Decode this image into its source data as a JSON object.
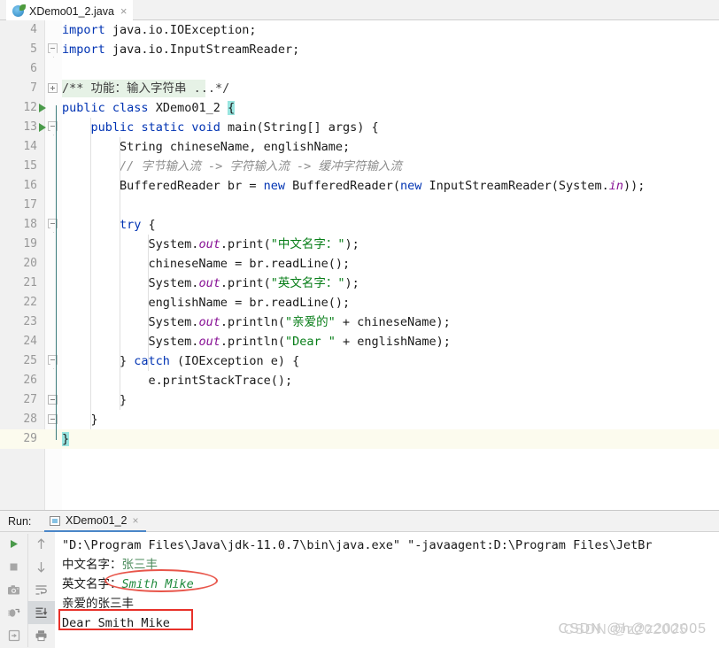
{
  "editor_tab": {
    "label": "XDemo01_2.java",
    "icon": "java-class-icon",
    "close": "×"
  },
  "code": {
    "lines": [
      {
        "num": "4",
        "indent": 0,
        "gutter": "none",
        "text": "import java.io.IOException;",
        "tokens": [
          {
            "t": "import",
            "c": "kw"
          },
          {
            "t": " java.io.IOException;",
            "c": ""
          }
        ]
      },
      {
        "num": "5",
        "indent": 0,
        "gutter": "fold-arrow",
        "text": "import java.io.InputStreamReader;",
        "tokens": [
          {
            "t": "import",
            "c": "kw"
          },
          {
            "t": " java.io.InputStreamReader;",
            "c": ""
          }
        ]
      },
      {
        "num": "6",
        "indent": 0,
        "gutter": "none",
        "text": "",
        "tokens": []
      },
      {
        "num": "7",
        "indent": 0,
        "gutter": "fold-plus",
        "folded_comment": true,
        "text": "/** 功能：输入字符串 ...*/",
        "tokens": [
          {
            "t": "/** 功能：输入字符串 ...*/",
            "c": "cmtdoc"
          }
        ]
      },
      {
        "num": "12",
        "indent": 0,
        "gutter": "run-arrow",
        "text": "public class XDemo01_2 {",
        "tokens": [
          {
            "t": "public",
            "c": "kw"
          },
          {
            "t": " ",
            "c": ""
          },
          {
            "t": "class",
            "c": "kw"
          },
          {
            "t": " XDemo01_2 ",
            "c": ""
          },
          {
            "t": "{",
            "c": "brace-hl"
          }
        ]
      },
      {
        "num": "13",
        "indent": 1,
        "gutter": "run-arrow-fold",
        "text": "    public static void main(String[] args) {",
        "tokens": [
          {
            "t": "    ",
            "c": ""
          },
          {
            "t": "public",
            "c": "kw"
          },
          {
            "t": " ",
            "c": ""
          },
          {
            "t": "static",
            "c": "kw"
          },
          {
            "t": " ",
            "c": ""
          },
          {
            "t": "void",
            "c": "kw"
          },
          {
            "t": " main(String[] args) {",
            "c": ""
          }
        ]
      },
      {
        "num": "14",
        "indent": 2,
        "gutter": "none",
        "text": "        String chineseName, englishName;",
        "tokens": [
          {
            "t": "        String chineseName, englishName;",
            "c": ""
          }
        ]
      },
      {
        "num": "15",
        "indent": 2,
        "gutter": "none",
        "text": "        // 字节输入流 -> 字符输入流 -> 缓冲字符输入流",
        "tokens": [
          {
            "t": "        ",
            "c": ""
          },
          {
            "t": "// 字节输入流 -> 字符输入流 -> 缓冲字符输入流",
            "c": "cmt"
          }
        ]
      },
      {
        "num": "16",
        "indent": 2,
        "gutter": "none",
        "text": "        BufferedReader br = new BufferedReader(new InputStreamReader(System.in));",
        "tokens": [
          {
            "t": "        BufferedReader br = ",
            "c": ""
          },
          {
            "t": "new",
            "c": "kw"
          },
          {
            "t": " BufferedReader(",
            "c": ""
          },
          {
            "t": "new",
            "c": "kw"
          },
          {
            "t": " InputStreamReader(System.",
            "c": ""
          },
          {
            "t": "in",
            "c": "fld"
          },
          {
            "t": "));",
            "c": ""
          }
        ]
      },
      {
        "num": "17",
        "indent": 2,
        "gutter": "none",
        "text": "",
        "tokens": []
      },
      {
        "num": "18",
        "indent": 2,
        "gutter": "fold-arrow2",
        "text": "        try {",
        "tokens": [
          {
            "t": "        ",
            "c": ""
          },
          {
            "t": "try",
            "c": "kw"
          },
          {
            "t": " {",
            "c": ""
          }
        ]
      },
      {
        "num": "19",
        "indent": 3,
        "gutter": "none",
        "text": "            System.out.print(\"中文名字：\");",
        "tokens": [
          {
            "t": "            System.",
            "c": ""
          },
          {
            "t": "out",
            "c": "fld"
          },
          {
            "t": ".print(",
            "c": ""
          },
          {
            "t": "\"中文名字：\"",
            "c": "str"
          },
          {
            "t": ");",
            "c": ""
          }
        ]
      },
      {
        "num": "20",
        "indent": 3,
        "gutter": "none",
        "text": "            chineseName = br.readLine();",
        "tokens": [
          {
            "t": "            chineseName = br.readLine();",
            "c": ""
          }
        ]
      },
      {
        "num": "21",
        "indent": 3,
        "gutter": "none",
        "text": "            System.out.print(\"英文名字：\");",
        "tokens": [
          {
            "t": "            System.",
            "c": ""
          },
          {
            "t": "out",
            "c": "fld"
          },
          {
            "t": ".print(",
            "c": ""
          },
          {
            "t": "\"英文名字：\"",
            "c": "str"
          },
          {
            "t": ");",
            "c": ""
          }
        ]
      },
      {
        "num": "22",
        "indent": 3,
        "gutter": "none",
        "text": "            englishName = br.readLine();",
        "tokens": [
          {
            "t": "            englishName = br.readLine();",
            "c": ""
          }
        ]
      },
      {
        "num": "23",
        "indent": 3,
        "gutter": "none",
        "text": "            System.out.println(\"亲爱的\" + chineseName);",
        "tokens": [
          {
            "t": "            System.",
            "c": ""
          },
          {
            "t": "out",
            "c": "fld"
          },
          {
            "t": ".println(",
            "c": ""
          },
          {
            "t": "\"亲爱的\"",
            "c": "str"
          },
          {
            "t": " + chineseName);",
            "c": ""
          }
        ]
      },
      {
        "num": "24",
        "indent": 3,
        "gutter": "none",
        "text": "            System.out.println(\"Dear \" + englishName);",
        "tokens": [
          {
            "t": "            System.",
            "c": ""
          },
          {
            "t": "out",
            "c": "fld"
          },
          {
            "t": ".println(",
            "c": ""
          },
          {
            "t": "\"Dear \"",
            "c": "str"
          },
          {
            "t": " + englishName);",
            "c": ""
          }
        ]
      },
      {
        "num": "25",
        "indent": 2,
        "gutter": "fold-arrow2",
        "text": "        } catch (IOException e) {",
        "tokens": [
          {
            "t": "        } ",
            "c": ""
          },
          {
            "t": "catch",
            "c": "kw"
          },
          {
            "t": " (IOException e) {",
            "c": ""
          }
        ]
      },
      {
        "num": "26",
        "indent": 3,
        "gutter": "none",
        "text": "            e.printStackTrace();",
        "tokens": [
          {
            "t": "            e.printStackTrace();",
            "c": ""
          }
        ]
      },
      {
        "num": "27",
        "indent": 2,
        "gutter": "fold-minus",
        "text": "        }",
        "tokens": [
          {
            "t": "        }",
            "c": ""
          }
        ]
      },
      {
        "num": "28",
        "indent": 1,
        "gutter": "fold-minus",
        "text": "    }",
        "tokens": [
          {
            "t": "    }",
            "c": ""
          }
        ]
      },
      {
        "num": "29",
        "indent": 0,
        "gutter": "none",
        "caret": true,
        "text": "}",
        "tokens": [
          {
            "t": "}",
            "c": "brace-hl"
          }
        ]
      }
    ]
  },
  "run_window": {
    "title": "Run:",
    "tab_label": "XDemo01_2",
    "tab_close": "×",
    "toolbar_left": [
      {
        "name": "rerun-button",
        "icon": "play-icon"
      },
      {
        "name": "stop-button",
        "icon": "stop-icon"
      },
      {
        "name": "screenshot-button",
        "icon": "camera-icon"
      },
      {
        "name": "rerun-failed-tests-button",
        "icon": "debug-rerun-icon"
      },
      {
        "name": "export-button",
        "icon": "export-icon"
      }
    ],
    "toolbar_right": [
      {
        "name": "up-button",
        "icon": "arrow-up-icon"
      },
      {
        "name": "down-button",
        "icon": "arrow-down-icon"
      },
      {
        "name": "soft-wrap-button",
        "icon": "soft-wrap-icon"
      },
      {
        "name": "scroll-to-end-button",
        "icon": "scroll-to-end-icon",
        "active": true
      },
      {
        "name": "print-button",
        "icon": "print-icon"
      }
    ],
    "console": {
      "lines": [
        {
          "name": "console-command-line",
          "segments": [
            {
              "t": "\"D:\\Program Files\\Java\\jdk-11.0.7\\bin\\java.exe\" \"-javaagent:D:\\Program Files\\JetBr",
              "c": ""
            }
          ]
        },
        {
          "name": "console-prompt-chinese",
          "segments": [
            {
              "t": "中文名字：",
              "c": ""
            },
            {
              "t": "张三丰",
              "c": "cin-plain"
            }
          ]
        },
        {
          "name": "console-prompt-english",
          "segments": [
            {
              "t": "英文名字：",
              "c": ""
            },
            {
              "t": "Smith Mike",
              "c": "cin"
            }
          ]
        },
        {
          "name": "console-output-chinese",
          "segments": [
            {
              "t": "亲爱的张三丰",
              "c": ""
            }
          ]
        },
        {
          "name": "console-output-english",
          "segments": [
            {
              "t": "Dear Smith Mike",
              "c": ""
            }
          ]
        }
      ]
    }
  },
  "annotations": {
    "ellipse": {
      "name": "red-ellipse-annotation",
      "color": "#e8554a"
    },
    "rectangle": {
      "name": "red-rectangle-annotation",
      "color": "#e8312a"
    }
  },
  "watermark": {
    "text_a": "CSDN @h@z202005",
    "text_b": "CSDN @z202005"
  }
}
